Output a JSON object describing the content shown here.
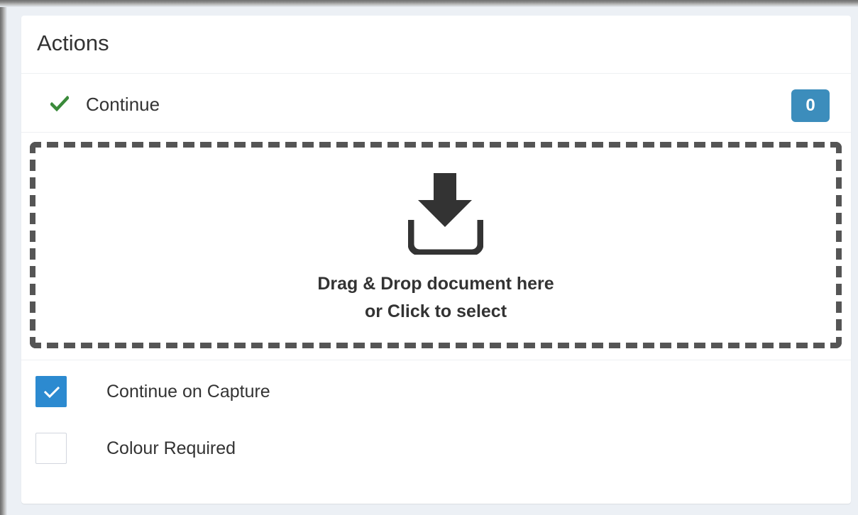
{
  "panel": {
    "title": "Actions"
  },
  "continue_row": {
    "label": "Continue",
    "badge_count": "0",
    "check_color": "#3a8a3a"
  },
  "dropzone": {
    "icon": "download-icon",
    "line1": "Drag & Drop document here",
    "line2": "or Click to select"
  },
  "options": [
    {
      "label": "Continue on Capture",
      "checked": true
    },
    {
      "label": "Colour Required",
      "checked": false
    }
  ],
  "colors": {
    "accent": "#3c8dbc",
    "checkbox_checked": "#2c8ad0",
    "text": "#333333",
    "background": "#ecf0f5"
  }
}
